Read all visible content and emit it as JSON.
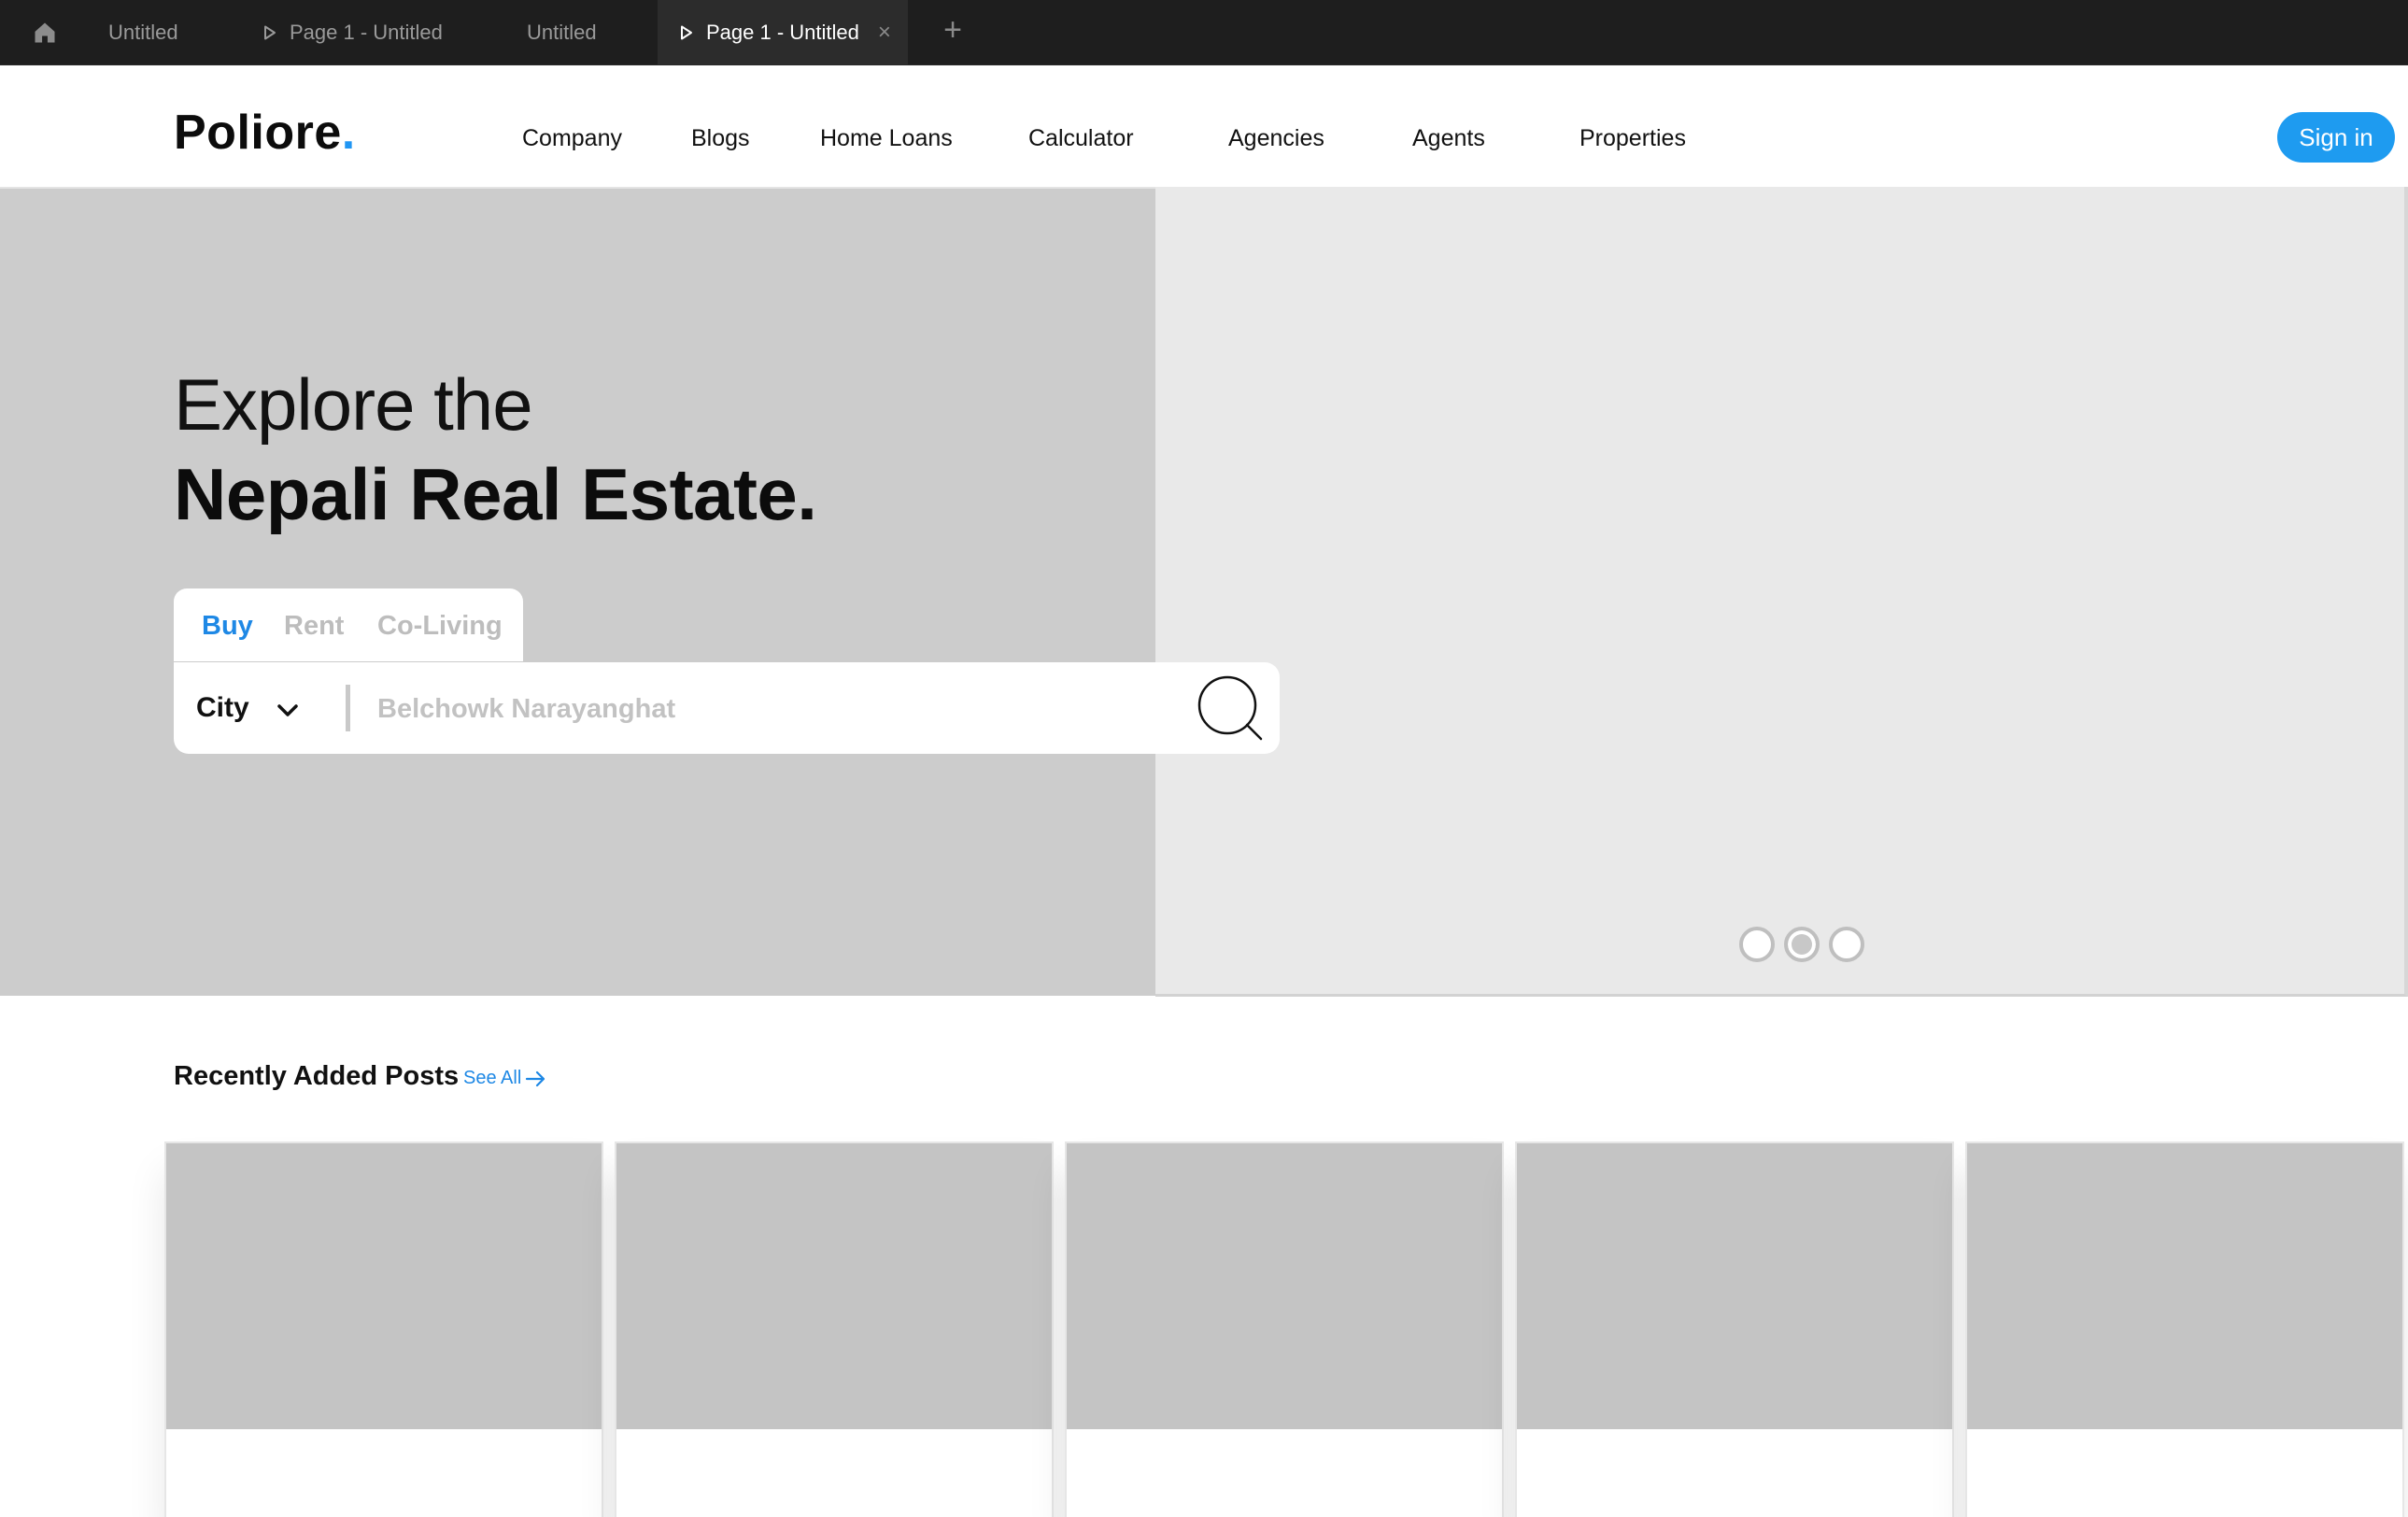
{
  "app": {
    "tabs": [
      {
        "label": "Untitled",
        "has_play": false,
        "active": false
      },
      {
        "label": "Page 1 - Untitled",
        "has_play": true,
        "active": false
      },
      {
        "label": "Untitled",
        "has_play": false,
        "active": false
      },
      {
        "label": "Page 1 - Untitled",
        "has_play": true,
        "active": true
      }
    ],
    "icons": {
      "home": "home-icon",
      "play": "play-icon",
      "close": "close-icon",
      "new_tab": "plus-icon"
    },
    "new_tab_label": "+",
    "close_label": "×"
  },
  "site": {
    "logo": {
      "text": "Poliore",
      "dot": "."
    },
    "nav": [
      "Company",
      "Blogs",
      "Home Loans",
      "Calculator",
      "Agencies",
      "Agents",
      "Properties"
    ],
    "sign_in": "Sign in",
    "accent_color": "#1e9bf0"
  },
  "hero": {
    "title_line1": "Explore the",
    "title_line2": "Nepali Real Estate.",
    "modes": [
      "Buy",
      "Rent",
      "Co-Living"
    ],
    "active_mode": "Buy",
    "city_label": "City",
    "search_placeholder": "Belchowk Narayanghat",
    "search_value": "",
    "carousel": {
      "count": 3,
      "active_index": 1
    }
  },
  "recent": {
    "title": "Recently Added Posts",
    "see_all": "See All",
    "card_count": 5
  }
}
